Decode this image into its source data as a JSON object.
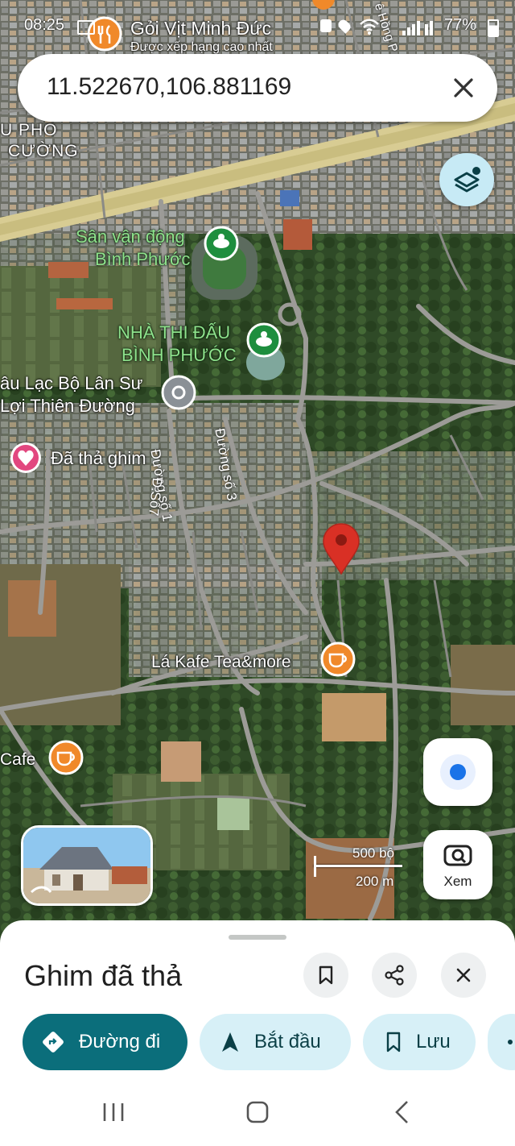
{
  "status_bar": {
    "time": "08:25",
    "battery": "77%"
  },
  "search": {
    "value": "11.522670,106.881169"
  },
  "map": {
    "labels": {
      "top_poi": "Gỏi Vịt Minh Đức",
      "top_poi_sub": "Được xếp hạng cao nhất",
      "area_line1": "U PHO",
      "area_line2": "CƯỜNG",
      "stadium_line1": "Sân vận động",
      "stadium_line2": "Bình Phước",
      "arena_line1": "NHÀ THI ĐẤU",
      "arena_line2": "BÌNH PHƯỚC",
      "club_line1": "âu Lạc Bộ Lân Sư",
      "club_line2": "Lợi Thiên Đường",
      "dropped_pin": "Đã thả ghim",
      "street_1": "Đường số 1",
      "street_3": "Đường số 3",
      "street_7": "Đ.Số7",
      "cafe_1": "Lá Kafe Tea&more",
      "cafe_2": "Cafe",
      "top_right_road": "ê Hồng P"
    },
    "scale": {
      "imperial": "500 bộ",
      "metric": "200 m"
    },
    "lens_label": "Xem"
  },
  "sheet": {
    "title": "Ghim đã thả",
    "actions": {
      "directions": "Đường đi",
      "start": "Bắt đầu",
      "save": "Lưu"
    }
  },
  "colors": {
    "accent": "#0b6e7b",
    "chip_bg": "#d7f0f7",
    "pin": "#d93025",
    "cafe": "#f0892a",
    "green_poi": "#1e8e3e"
  }
}
